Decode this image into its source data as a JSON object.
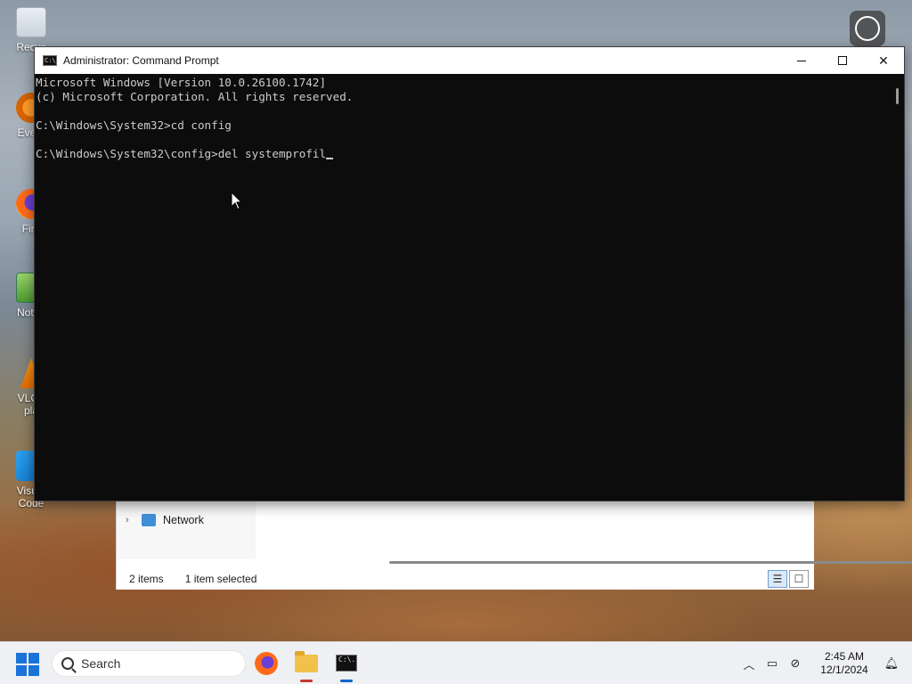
{
  "desktop": {
    "icons": [
      {
        "label": "Recyc"
      },
      {
        "label": "Every"
      },
      {
        "label": "Fire"
      },
      {
        "label": "Notep"
      },
      {
        "label": "VLC r\npla"
      },
      {
        "label": "Visual\nCode"
      }
    ]
  },
  "cmd": {
    "title": "Administrator: Command Prompt",
    "icon_text": "C:\\.",
    "lines": [
      "Microsoft Windows [Version 10.0.26100.1742]",
      "(c) Microsoft Corporation. All rights reserved.",
      "",
      "C:\\Windows\\System32>cd config",
      "",
      "C:\\Windows\\System32\\config>del systemprofil"
    ]
  },
  "explorer": {
    "nav_item": "Network",
    "status_items": "2 items",
    "status_selected": "1 item selected"
  },
  "taskbar": {
    "search_placeholder": "Search",
    "time": "2:45 AM",
    "date": "12/1/2024"
  }
}
